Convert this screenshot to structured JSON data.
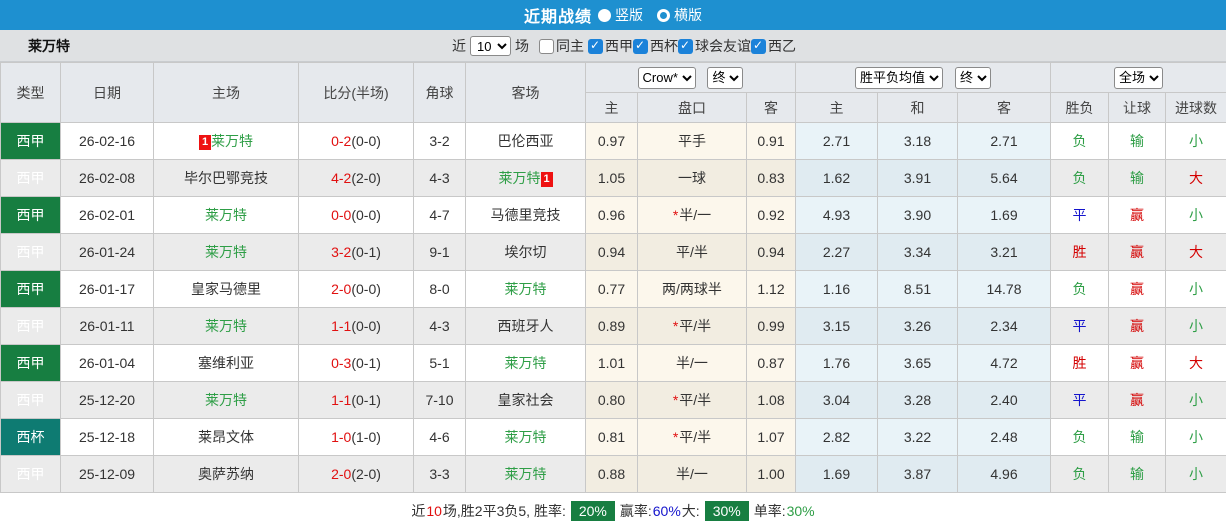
{
  "title_bar": {
    "title": "近期战绩",
    "options": [
      {
        "label": "竖版",
        "selected": true
      },
      {
        "label": "横版",
        "selected": false
      }
    ]
  },
  "filter_bar": {
    "team": "莱万特",
    "near_label": "近",
    "count_value": "10",
    "count_suffix": "场",
    "same_home_label": "同主",
    "same_home_checked": false,
    "leagues": [
      {
        "label": "西甲",
        "checked": true
      },
      {
        "label": "西杯",
        "checked": true
      },
      {
        "label": "球会友谊",
        "checked": true
      },
      {
        "label": "西乙",
        "checked": true
      }
    ]
  },
  "table": {
    "main_headers": [
      "类型",
      "日期",
      "主场",
      "比分(半场)",
      "角球",
      "客场"
    ],
    "selects": {
      "odds_company": "Crow*",
      "odds_time": "终",
      "avg_label": "胜平负均值",
      "avg_time": "终",
      "scope": "全场"
    },
    "sub_headers": [
      "主",
      "盘口",
      "客",
      "主",
      "和",
      "客",
      "胜负",
      "让球",
      "进球数"
    ],
    "rows": [
      {
        "league": "西甲",
        "league_color": "green",
        "date": "26-02-16",
        "home": "莱万特",
        "home_target": true,
        "home_badge": "1",
        "home_badge_pos": "before",
        "away": "巴伦西亚",
        "away_target": false,
        "away_badge": "",
        "away_badge_pos": "",
        "score": "0-2",
        "half": "(0-0)",
        "corners": "3-2",
        "odds_home": "0.97",
        "handicap": "平手",
        "handicap_star": false,
        "odds_away": "0.91",
        "avg_home": "2.71",
        "avg_draw": "3.18",
        "avg_away": "2.71",
        "result": "负",
        "result_color": "green",
        "handicap_result": "输",
        "handicap_result_color": "green",
        "goals": "小",
        "goals_color": "green"
      },
      {
        "league": "西甲",
        "league_color": "green",
        "date": "26-02-08",
        "home": "毕尔巴鄂竞技",
        "home_target": false,
        "home_badge": "",
        "home_badge_pos": "",
        "away": "莱万特",
        "away_target": true,
        "away_badge": "1",
        "away_badge_pos": "after",
        "score": "4-2",
        "half": "(2-0)",
        "corners": "4-3",
        "odds_home": "1.05",
        "handicap": "一球",
        "handicap_star": false,
        "odds_away": "0.83",
        "avg_home": "1.62",
        "avg_draw": "3.91",
        "avg_away": "5.64",
        "result": "负",
        "result_color": "green",
        "handicap_result": "输",
        "handicap_result_color": "green",
        "goals": "大",
        "goals_color": "red"
      },
      {
        "league": "西甲",
        "league_color": "green",
        "date": "26-02-01",
        "home": "莱万特",
        "home_target": true,
        "home_badge": "",
        "home_badge_pos": "",
        "away": "马德里竞技",
        "away_target": false,
        "away_badge": "",
        "away_badge_pos": "",
        "score": "0-0",
        "half": "(0-0)",
        "corners": "4-7",
        "odds_home": "0.96",
        "handicap": "半/一",
        "handicap_star": true,
        "odds_away": "0.92",
        "avg_home": "4.93",
        "avg_draw": "3.90",
        "avg_away": "1.69",
        "result": "平",
        "result_color": "blue",
        "handicap_result": "赢",
        "handicap_result_color": "red",
        "goals": "小",
        "goals_color": "green"
      },
      {
        "league": "西甲",
        "league_color": "green",
        "date": "26-01-24",
        "home": "莱万特",
        "home_target": true,
        "home_badge": "",
        "home_badge_pos": "",
        "away": "埃尔切",
        "away_target": false,
        "away_badge": "",
        "away_badge_pos": "",
        "score": "3-2",
        "half": "(0-1)",
        "corners": "9-1",
        "odds_home": "0.94",
        "handicap": "平/半",
        "handicap_star": false,
        "odds_away": "0.94",
        "avg_home": "2.27",
        "avg_draw": "3.34",
        "avg_away": "3.21",
        "result": "胜",
        "result_color": "red",
        "handicap_result": "赢",
        "handicap_result_color": "red",
        "goals": "大",
        "goals_color": "red"
      },
      {
        "league": "西甲",
        "league_color": "green",
        "date": "26-01-17",
        "home": "皇家马德里",
        "home_target": false,
        "home_badge": "",
        "home_badge_pos": "",
        "away": "莱万特",
        "away_target": true,
        "away_badge": "",
        "away_badge_pos": "",
        "score": "2-0",
        "half": "(0-0)",
        "corners": "8-0",
        "odds_home": "0.77",
        "handicap": "两/两球半",
        "handicap_star": false,
        "odds_away": "1.12",
        "avg_home": "1.16",
        "avg_draw": "8.51",
        "avg_away": "14.78",
        "result": "负",
        "result_color": "green",
        "handicap_result": "赢",
        "handicap_result_color": "red",
        "goals": "小",
        "goals_color": "green"
      },
      {
        "league": "西甲",
        "league_color": "green",
        "date": "26-01-11",
        "home": "莱万特",
        "home_target": true,
        "home_badge": "",
        "home_badge_pos": "",
        "away": "西班牙人",
        "away_target": false,
        "away_badge": "",
        "away_badge_pos": "",
        "score": "1-1",
        "half": "(0-0)",
        "corners": "4-3",
        "odds_home": "0.89",
        "handicap": "平/半",
        "handicap_star": true,
        "odds_away": "0.99",
        "avg_home": "3.15",
        "avg_draw": "3.26",
        "avg_away": "2.34",
        "result": "平",
        "result_color": "blue",
        "handicap_result": "赢",
        "handicap_result_color": "red",
        "goals": "小",
        "goals_color": "green"
      },
      {
        "league": "西甲",
        "league_color": "green",
        "date": "26-01-04",
        "home": "塞维利亚",
        "home_target": false,
        "home_badge": "",
        "home_badge_pos": "",
        "away": "莱万特",
        "away_target": true,
        "away_badge": "",
        "away_badge_pos": "",
        "score": "0-3",
        "half": "(0-1)",
        "corners": "5-1",
        "odds_home": "1.01",
        "handicap": "半/一",
        "handicap_star": false,
        "odds_away": "0.87",
        "avg_home": "1.76",
        "avg_draw": "3.65",
        "avg_away": "4.72",
        "result": "胜",
        "result_color": "red",
        "handicap_result": "赢",
        "handicap_result_color": "red",
        "goals": "大",
        "goals_color": "red"
      },
      {
        "league": "西甲",
        "league_color": "green",
        "date": "25-12-20",
        "home": "莱万特",
        "home_target": true,
        "home_badge": "",
        "home_badge_pos": "",
        "away": "皇家社会",
        "away_target": false,
        "away_badge": "",
        "away_badge_pos": "",
        "score": "1-1",
        "half": "(0-1)",
        "corners": "7-10",
        "odds_home": "0.80",
        "handicap": "平/半",
        "handicap_star": true,
        "odds_away": "1.08",
        "avg_home": "3.04",
        "avg_draw": "3.28",
        "avg_away": "2.40",
        "result": "平",
        "result_color": "blue",
        "handicap_result": "赢",
        "handicap_result_color": "red",
        "goals": "小",
        "goals_color": "green"
      },
      {
        "league": "西杯",
        "league_color": "teal",
        "date": "25-12-18",
        "home": "莱昂文体",
        "home_target": false,
        "home_badge": "",
        "home_badge_pos": "",
        "away": "莱万特",
        "away_target": true,
        "away_badge": "",
        "away_badge_pos": "",
        "score": "1-0",
        "half": "(1-0)",
        "corners": "4-6",
        "odds_home": "0.81",
        "handicap": "平/半",
        "handicap_star": true,
        "odds_away": "1.07",
        "avg_home": "2.82",
        "avg_draw": "3.22",
        "avg_away": "2.48",
        "result": "负",
        "result_color": "green",
        "handicap_result": "输",
        "handicap_result_color": "green",
        "goals": "小",
        "goals_color": "green"
      },
      {
        "league": "西甲",
        "league_color": "green",
        "date": "25-12-09",
        "home": "奥萨苏纳",
        "home_target": false,
        "home_badge": "",
        "home_badge_pos": "",
        "away": "莱万特",
        "away_target": true,
        "away_badge": "",
        "away_badge_pos": "",
        "score": "2-0",
        "half": "(2-0)",
        "corners": "3-3",
        "odds_home": "0.88",
        "handicap": "半/一",
        "handicap_star": false,
        "odds_away": "1.00",
        "avg_home": "1.69",
        "avg_draw": "3.87",
        "avg_away": "4.96",
        "result": "负",
        "result_color": "green",
        "handicap_result": "输",
        "handicap_result_color": "green",
        "goals": "小",
        "goals_color": "green"
      }
    ]
  },
  "footer": {
    "segments": [
      {
        "text": "近",
        "style": "plain"
      },
      {
        "text": "10",
        "style": "red"
      },
      {
        "text": "场,胜2平3负5, 胜率:",
        "style": "plain"
      },
      {
        "text": "20%",
        "style": "greenbox"
      },
      {
        "text": "赢率:",
        "style": "plain"
      },
      {
        "text": "60%",
        "style": "blue"
      },
      {
        "text": " 大:",
        "style": "plain"
      },
      {
        "text": "30%",
        "style": "greenbox"
      },
      {
        "text": "单率:",
        "style": "plain"
      },
      {
        "text": "30%",
        "style": "green"
      }
    ]
  },
  "colors": {
    "topbar_blue": "#1e90d0",
    "league_green": "#177e41",
    "league_teal": "#0e7b72",
    "target_team_green": "#2e9e46",
    "score_red": "#e11010",
    "draw_blue": "#1414cc"
  }
}
